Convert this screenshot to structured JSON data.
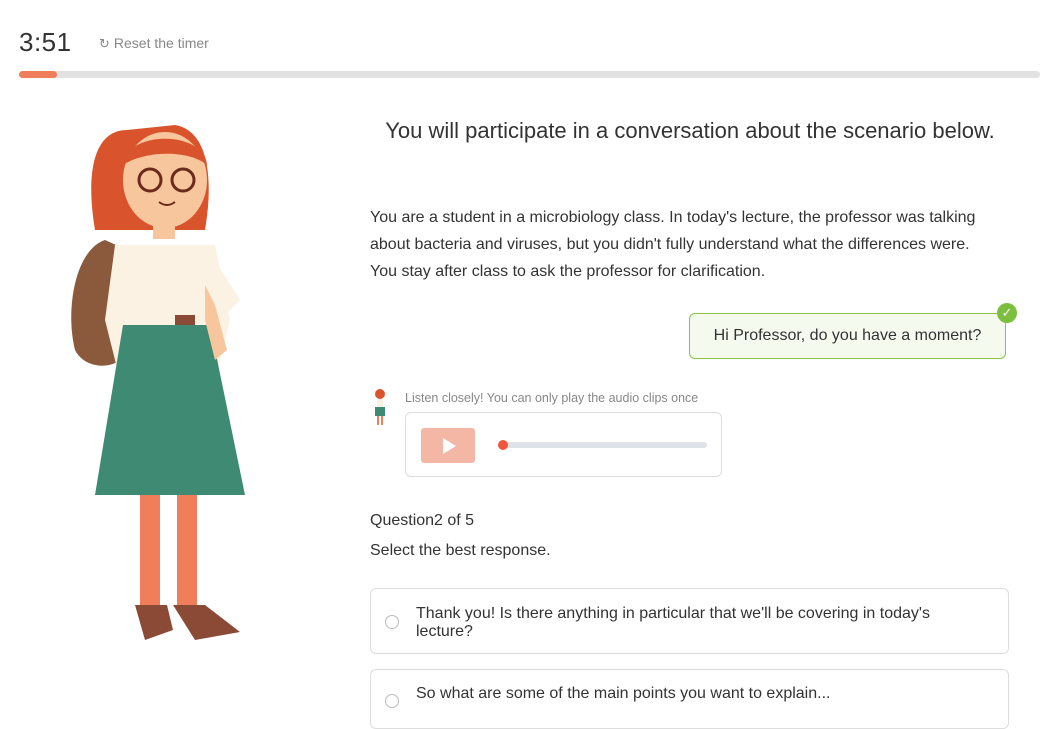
{
  "timer": {
    "value": "3:51",
    "reset_label": "Reset the timer",
    "reset_icon": "refresh-icon"
  },
  "progress": {
    "fraction": 0.037,
    "color": "#f07e5a"
  },
  "heading": "You will participate in a conversation about the scenario below.",
  "scenario": "You are a student in a microbiology class. In today's lecture, the professor was talking about bacteria and viruses, but you didn't fully understand what the differences were. You stay after class to ask the professor for clarification.",
  "conversation": {
    "student_message": "Hi Professor, do you have a moment?",
    "check_icon": "check-icon"
  },
  "audio": {
    "note": "Listen closely! You can only play the audio clips once",
    "play_icon": "play-icon",
    "position": 0
  },
  "question": {
    "count": "Question2 of 5",
    "prompt": "Select the best response.",
    "options": [
      {
        "text": "Thank you! Is there anything in particular that we'll be covering in today's lecture?"
      },
      {
        "text": "So what are some of the main points you want to explain..."
      }
    ]
  },
  "colors": {
    "accent": "#f07e5a",
    "success": "#7cbf3f",
    "play_button": "#f4b6a5"
  }
}
